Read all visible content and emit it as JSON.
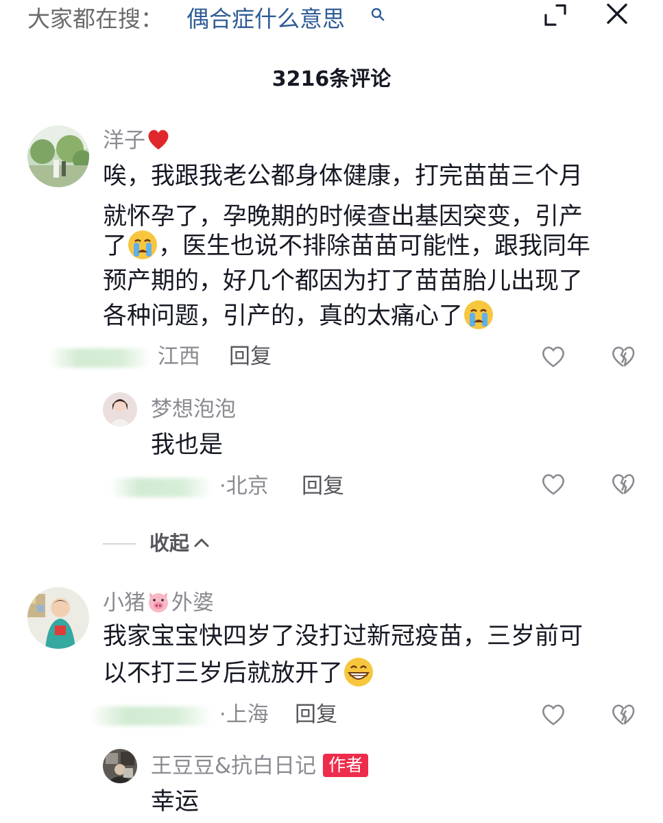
{
  "search": {
    "label": "大家都在搜：",
    "term": "偶合症什么意思",
    "search_icon": "search-icon"
  },
  "header": {
    "comment_count": "3216条评论",
    "expand_icon": "expand-icon",
    "close_icon": "close-icon"
  },
  "comments": [
    {
      "user": "洋子",
      "user_emoji": "red-heart",
      "lines": [
        "唉，我跟我老公都身体健康，打完苗苗三个月",
        "就怀孕了，孕晚期的时候查出基因突变，引产",
        "，医生也说不排除苗苗可能性，跟我同年",
        "预产期的，好几个都因为打了苗苗胎儿出现了",
        "各种问题，引产的，真的太痛心了"
      ],
      "line3_prefix": "了",
      "location": "江西",
      "reply": "回复"
    },
    {
      "user": "梦想泡泡",
      "text": "我也是",
      "location": "·北京",
      "reply": "回复"
    },
    {
      "user_prefix": "小猪",
      "user_suffix": "外婆",
      "user_emoji": "pig-face",
      "lines": [
        "我家宝宝快四岁了没打过新冠疫苗，三岁前可",
        "以不打三岁后就放开了"
      ],
      "location": "·上海",
      "reply": "回复"
    },
    {
      "user": "王豆豆&抗白日记",
      "badge": "作者",
      "text": "幸运"
    }
  ],
  "collapse": {
    "label": "收起"
  },
  "colors": {
    "search_term": "#2e5c96",
    "author_badge": "#ee2c4c",
    "muted_text": "#8a8b91"
  }
}
